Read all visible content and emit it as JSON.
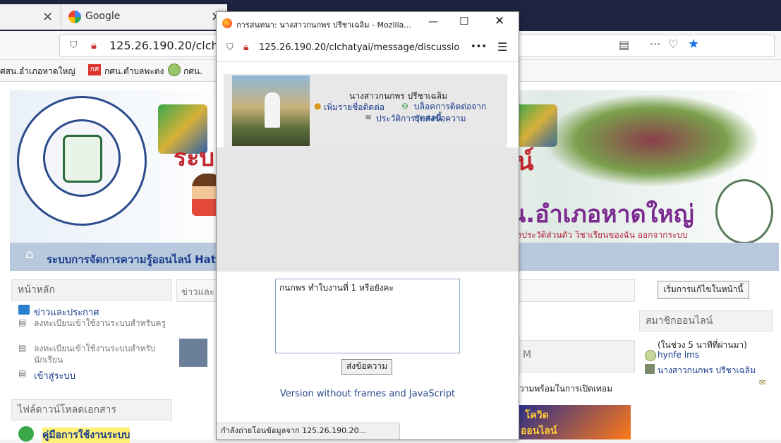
{
  "browser": {
    "tab1_close": "×",
    "tab2_title": "Google",
    "tab2_close": "×",
    "url": "125.26.190.20/clchatyai",
    "bookmarks": [
      "ศสน.อำเภอหาดใหญ่",
      "กศน.ตำบลพะตง",
      "กศน."
    ],
    "toolbar_more": "···"
  },
  "site": {
    "banner_title_partial": "ระบ",
    "banner_title_right": "น.อำเภอหาดใหญ่",
    "banner_cut": "น์",
    "user_links": "ลงประวัติส่วนตัว  วิชาเรียนของฉัน  ออกจากระบบ",
    "navbar_title": "ระบบการจัดการความรู้ออนไลน์ Hatya",
    "main_menu_header": "หน้าหลัก",
    "main_menu": [
      {
        "label": "ข่าวและประกาศ",
        "style": "link"
      },
      {
        "label": "ลงทะเบียนเข้าใช้งานระบบสำหรับครู",
        "style": "gray"
      },
      {
        "label": "ลงทะเบียนเข้าใช้งานระบบสำหรับนักเรียน",
        "style": "gray"
      },
      {
        "label": "เข้าสู่ระบบ",
        "style": "link"
      }
    ],
    "news_header": "ข่าวและ",
    "download_header": "ไฟล์ดาวน์โหลดเอกสาร",
    "manual_link": "คู่มือการใช้งานระบบ",
    "edit_button": "เริ่มการแก้ไขในหน้านี้",
    "online_header": "สมาชิกออนไลน์",
    "online_note": "(ในช่วง 5 นาทีที่ผ่านมา)",
    "online_users": [
      "hynfe lms",
      "นางสาวกนกพร ปรีชาเฉลิม"
    ],
    "news_snippet": "วามพร้อมในการเปิดเทอม",
    "news_initial": "M",
    "ad_text": "โควิด",
    "ad_text2": "ออนไลน์"
  },
  "popup": {
    "title": "การสนทนา: นางสาวกนกพร ปรีชาเฉลิม - Mozilla...",
    "url": "125.26.190.20/clchatyai/message/discussio",
    "url_more": "•••",
    "user_name": "นางสาวกนกพร ปรีชาเฉลิม",
    "add_contact": "เพิ่มรายชื่อติดต่อ",
    "block_contact": "บล็อคการติดต่อจากบุคคลนี้",
    "history": "ประวัติการรับส่งข้อความ",
    "message_text": "กนกพร ทำใบงานที่ 1 หรือยังคะ",
    "send_label": "ส่งข้อความ",
    "version_link": "Version without frames and JavaScript",
    "status_text": "กำลังถ่ายโอนข้อมูลจาก 125.26.190.20..."
  }
}
